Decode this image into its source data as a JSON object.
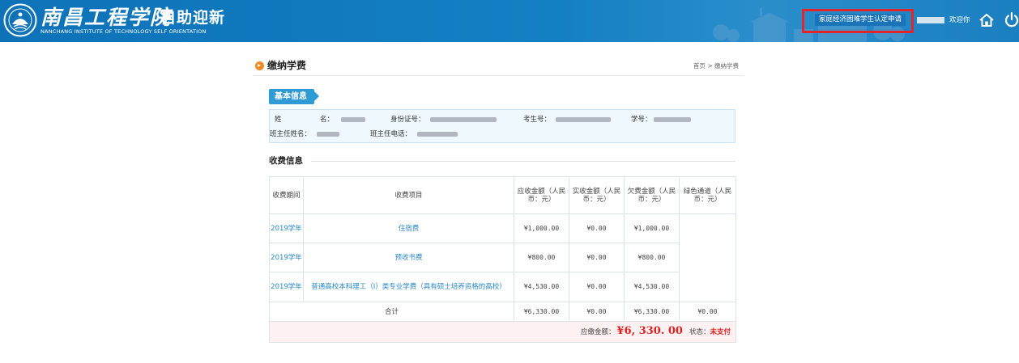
{
  "header": {
    "logo_cn": "南昌工程学院",
    "logo_suffix": "自助迎新",
    "logo_en": "NANCHANG INSTITUTE OF TECHNOLOGY  SELF ORIENTATION",
    "hardship_link": "家庭经济困难学生认定申请",
    "welcome": "欢迎你",
    "icons": [
      "seal-logo-icon",
      "home-icon",
      "power-icon"
    ]
  },
  "page": {
    "title": "缴纳学费",
    "breadcrumb_home": "首页",
    "breadcrumb_sep": ">",
    "breadcrumb_current": "缴纳学费"
  },
  "basic_info": {
    "section_label": "基本信息",
    "name_label_1": "姓",
    "name_label_2": "名：",
    "id_label": "身份证号：",
    "exam_no_label": "考生号：",
    "student_no_label": "学号：",
    "teacher_name_label": "班主任姓名：",
    "teacher_phone_label": "班主任电话："
  },
  "fees": {
    "section_label": "收费信息",
    "headers": {
      "period": "收费期间",
      "item": "收费项目",
      "receivable": "应收金额（人民币：元）",
      "received": "实收金额（人民币：元）",
      "owed": "欠费金额（人民币：元）",
      "green": "绿色通道（人民币：元）"
    },
    "rows": [
      {
        "period": "2019学年",
        "item": "住宿费",
        "receivable": "¥1,000.00",
        "received": "¥0.00",
        "owed": "¥1,000.00"
      },
      {
        "period": "2019学年",
        "item": "预收书费",
        "receivable": "¥800.00",
        "received": "¥0.00",
        "owed": "¥800.00"
      },
      {
        "period": "2019学年",
        "item": "普通高校本科理工（Ⅰ）类专业学费（具有硕士培养资格的高校）",
        "receivable": "¥4,530.00",
        "received": "¥0.00",
        "owed": "¥4,530.00"
      }
    ],
    "total": {
      "label": "合计",
      "receivable": "¥6,330.00",
      "received": "¥0.00",
      "owed": "¥6,330.00",
      "green": "¥0.00"
    },
    "due_label": "应缴金额：",
    "due_amount": "¥6, 330. 00",
    "status_label": "状态：",
    "status_value": "未支付"
  },
  "colors": {
    "header_blue": "#1480c4",
    "accent_blue": "#2f9bd5",
    "link_blue": "#2b8ac8",
    "alert_red": "#e02020",
    "highlight_box": "#e3242b",
    "title_dot": "#f08a24"
  }
}
